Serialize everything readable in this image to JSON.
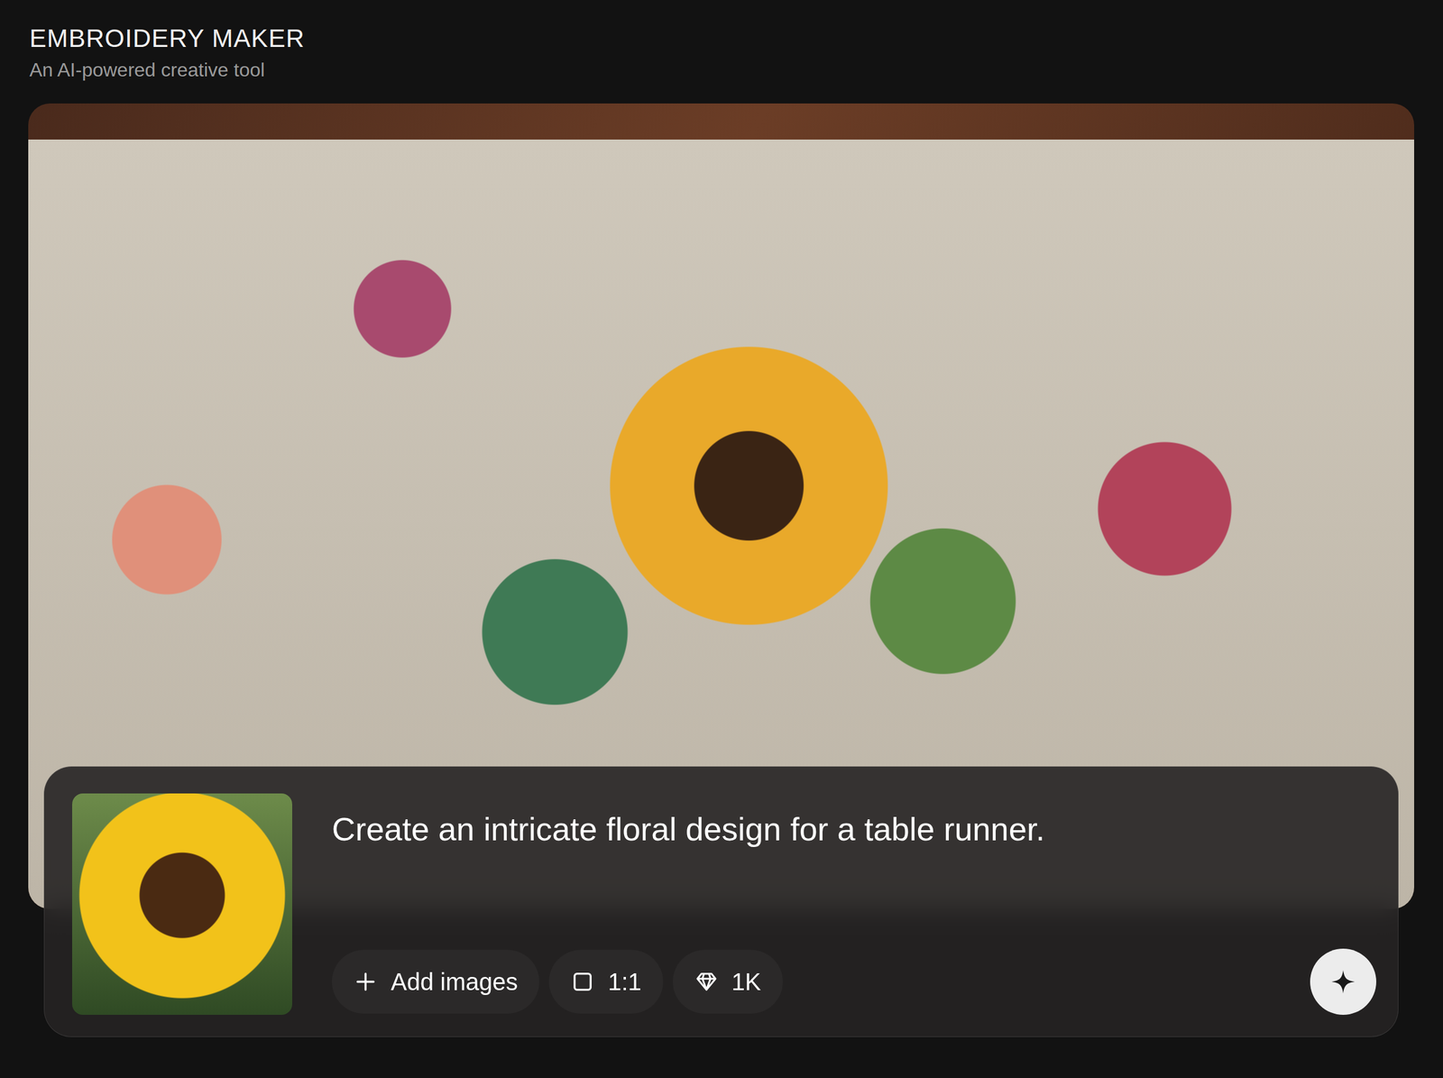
{
  "app": {
    "title": "EMBROIDERY MAKER",
    "subtitle": "An AI-powered creative tool"
  },
  "prompt": {
    "text": "Create an intricate floral design for a table runner."
  },
  "toolbar": [
    {
      "label": "Add images",
      "kind": "add"
    },
    {
      "label": "1:1",
      "kind": "aspect"
    },
    {
      "label": "1K",
      "kind": "quality"
    }
  ]
}
